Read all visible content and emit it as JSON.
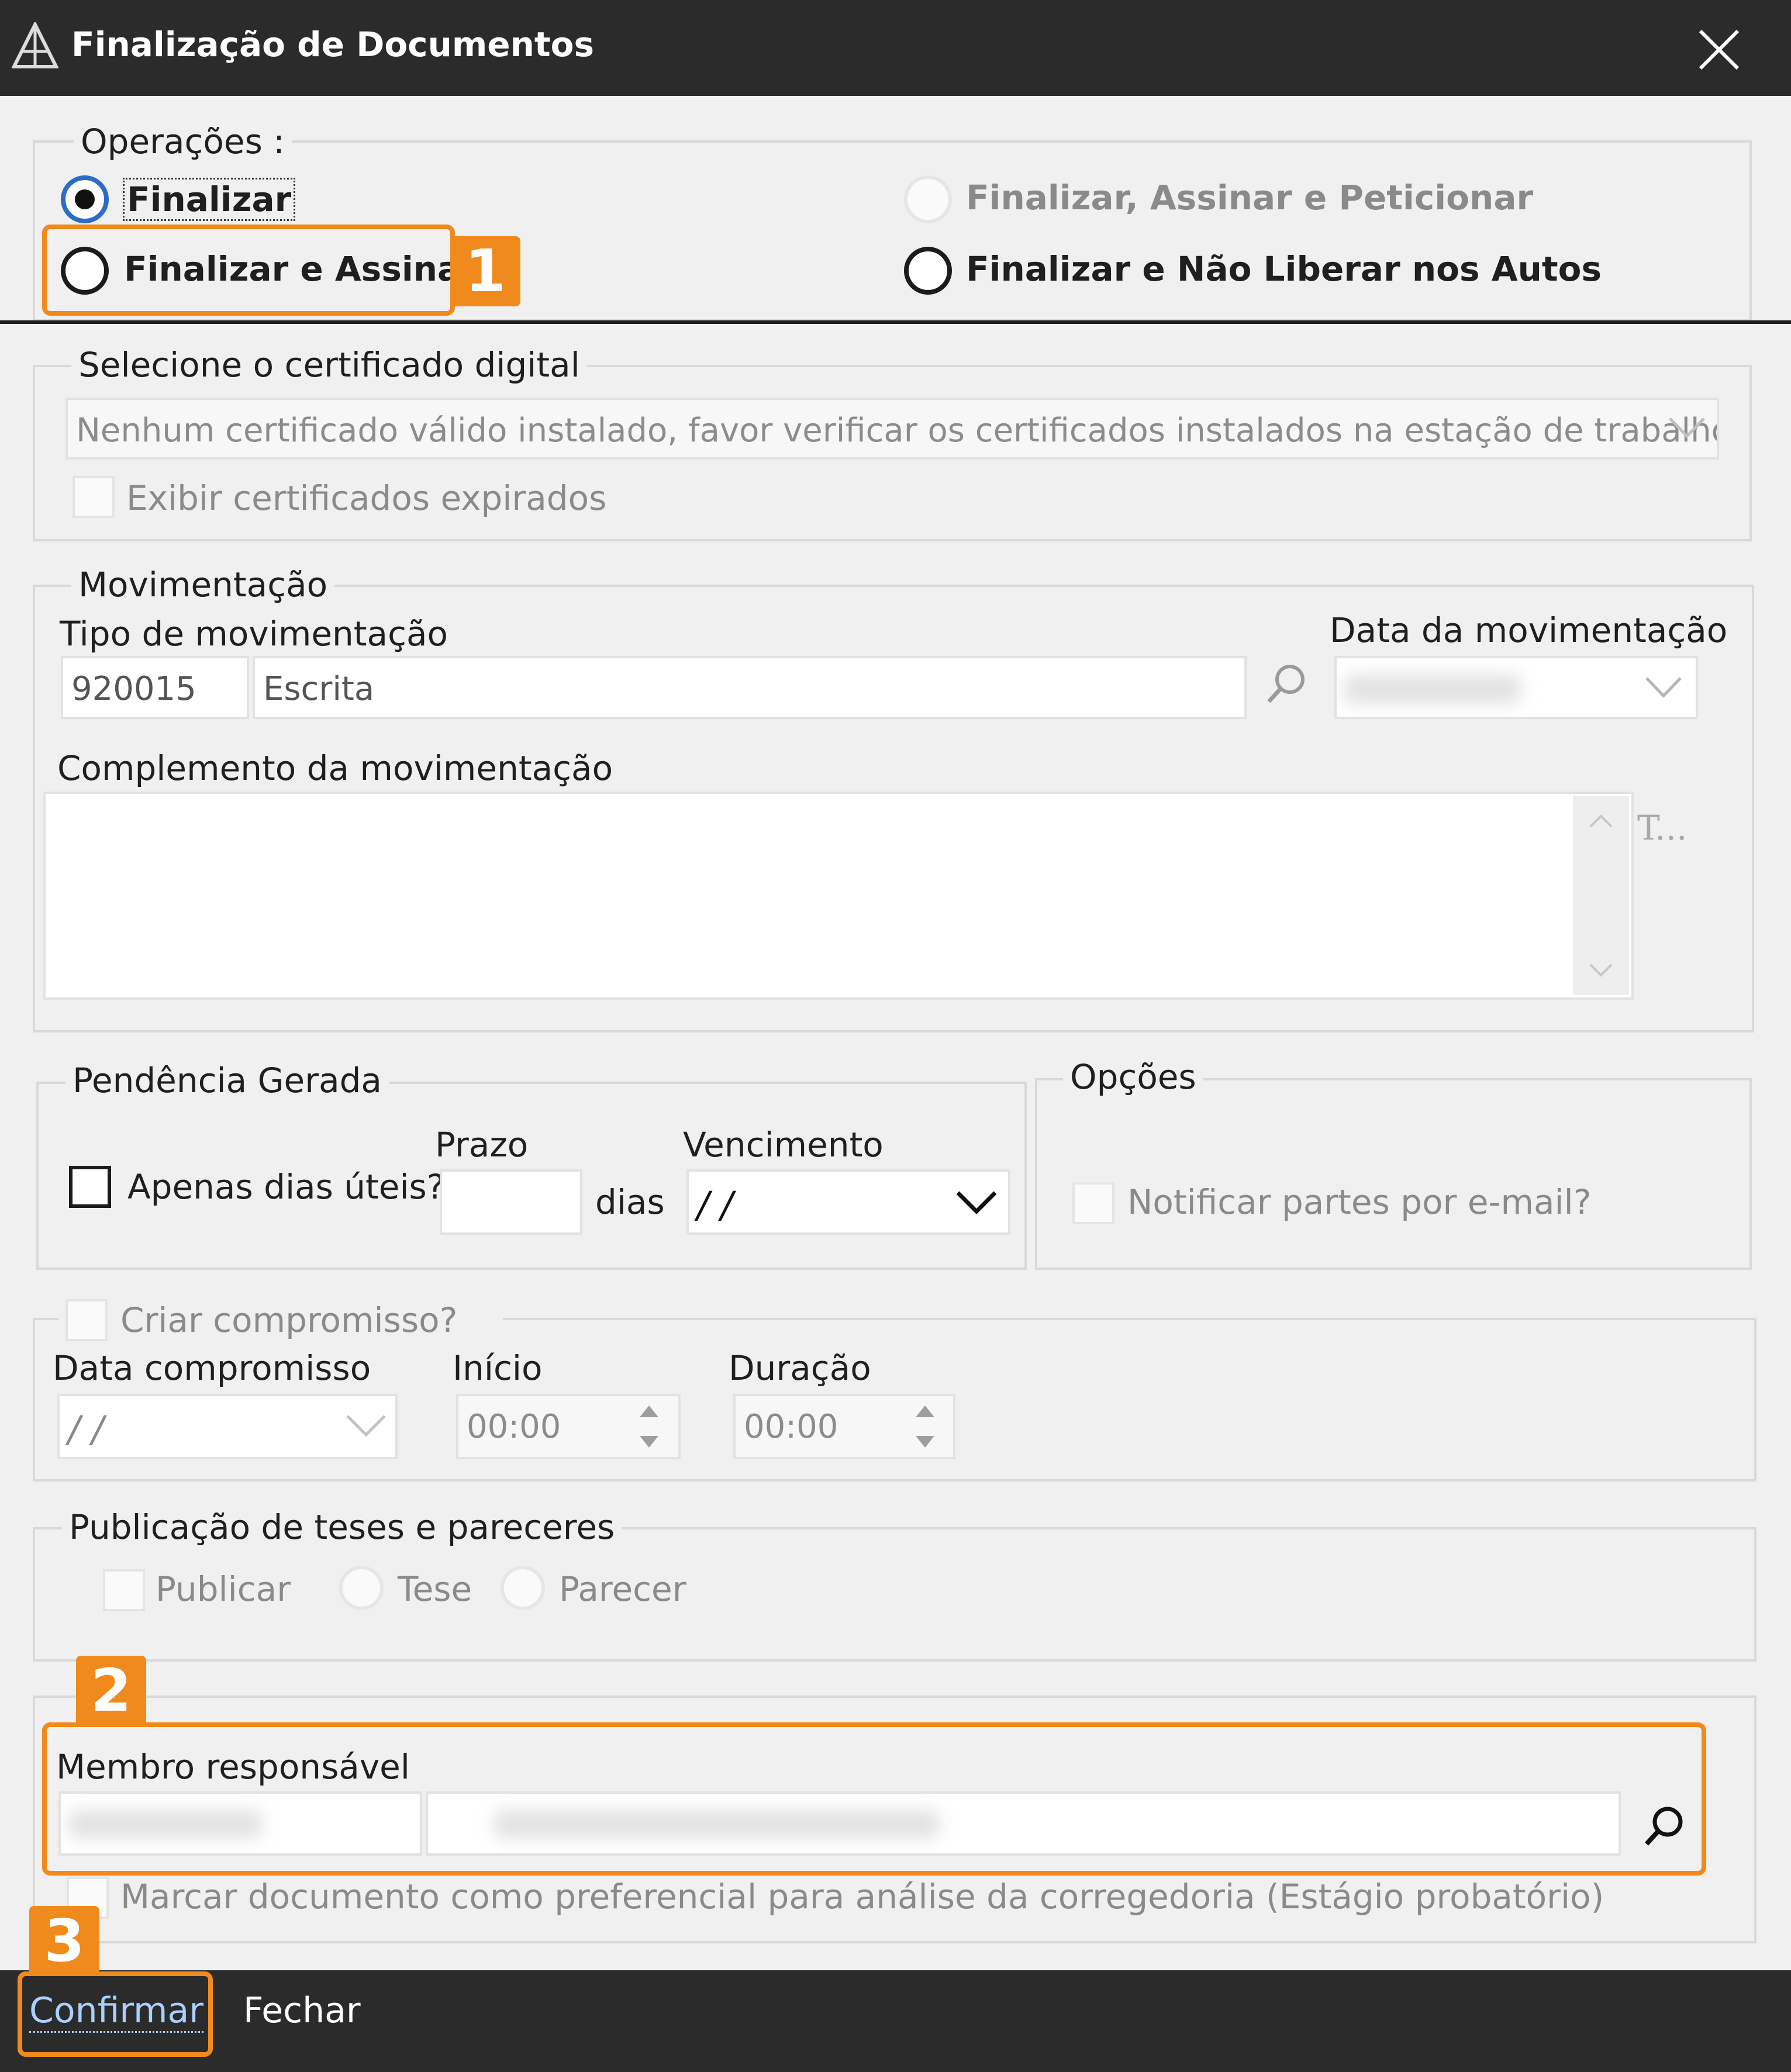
{
  "window": {
    "title": "Finalização de Documentos"
  },
  "operacoes": {
    "legend": "Operações :",
    "options": [
      {
        "label": "Finalizar",
        "checked": true,
        "enabled": true
      },
      {
        "label": "Finalizar e Assinar",
        "checked": false,
        "enabled": true
      },
      {
        "label": "Finalizar, Assinar e Peticionar",
        "checked": false,
        "enabled": false
      },
      {
        "label": "Finalizar e Não Liberar nos Autos",
        "checked": false,
        "enabled": true
      }
    ]
  },
  "certificado": {
    "legend": "Selecione o certificado digital",
    "select_value": "Nenhum certificado válido instalado, favor verificar os certificados instalados na estação de trabalho.",
    "checkbox_label": "Exibir certificados expirados"
  },
  "movimentacao": {
    "legend": "Movimentação",
    "tipo_label": "Tipo de movimentação",
    "tipo_code": "920015",
    "tipo_name": "Escrita",
    "data_label": "Data da movimentação",
    "complemento_label": "Complemento da movimentação",
    "side_text": "T..."
  },
  "pendencia": {
    "legend": "Pendência Gerada",
    "checkbox_label": "Apenas dias úteis?",
    "prazo_label": "Prazo",
    "dias_label": "dias",
    "vencimento_label": "Vencimento",
    "vencimento_value": "/ /"
  },
  "opcoes": {
    "legend": "Opções",
    "checkbox_label": "Notificar partes por e-mail?"
  },
  "compromisso": {
    "checkbox_label": "Criar compromisso?",
    "data_label": "Data compromisso",
    "data_value": "/ /",
    "inicio_label": "Início",
    "inicio_value": "00:00",
    "duracao_label": "Duração",
    "duracao_value": "00:00"
  },
  "publicacao": {
    "legend": "Publicação de teses e pareceres",
    "publicar_label": "Publicar",
    "tese_label": "Tese",
    "parecer_label": "Parecer"
  },
  "membro": {
    "label": "Membro responsável",
    "preferencial_label": "Marcar documento como preferencial para análise da corregedoria (Estágio probatório)"
  },
  "footer": {
    "confirmar": "Confirmar",
    "fechar": "Fechar"
  },
  "callouts": [
    "1",
    "2",
    "3"
  ],
  "colors": {
    "accent": "#f08a1c",
    "titlebar": "#2b2b2b"
  }
}
